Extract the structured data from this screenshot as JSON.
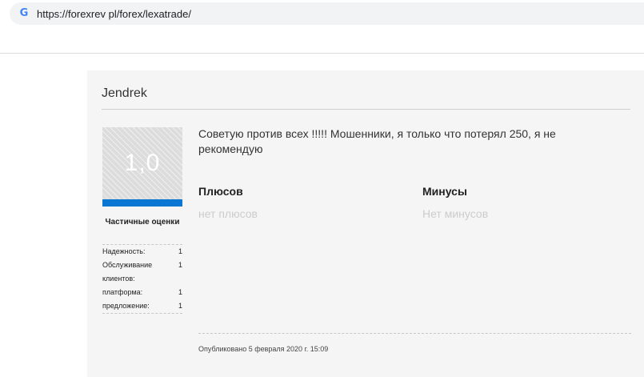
{
  "browser": {
    "url": "https://forexrev pl/forex/lexatrade/",
    "site_icon": "google-g-icon",
    "site_icon_glyph": "G"
  },
  "review": {
    "author": "Jendrek",
    "score": "1,0",
    "score_bar_color": "#0a78d2",
    "partial_ratings_title": "Частичные оценки",
    "ratings": [
      {
        "label": "Надежность:",
        "value": "1"
      },
      {
        "label": "Обслуживание клиентов:",
        "value": "1"
      },
      {
        "label": "платформа:",
        "value": "1"
      },
      {
        "label": "предложение:",
        "value": "1"
      }
    ],
    "text": "Советую против всех !!!!! Мошенники, я только что потерял 250, я не рекомендую",
    "pros_title": "Плюсов",
    "pros_value": "нет плюсов",
    "cons_title": "Минусы",
    "cons_value": "Нет минусов",
    "published": "Опубликовано 5 февраля 2020 г. 15:09"
  }
}
